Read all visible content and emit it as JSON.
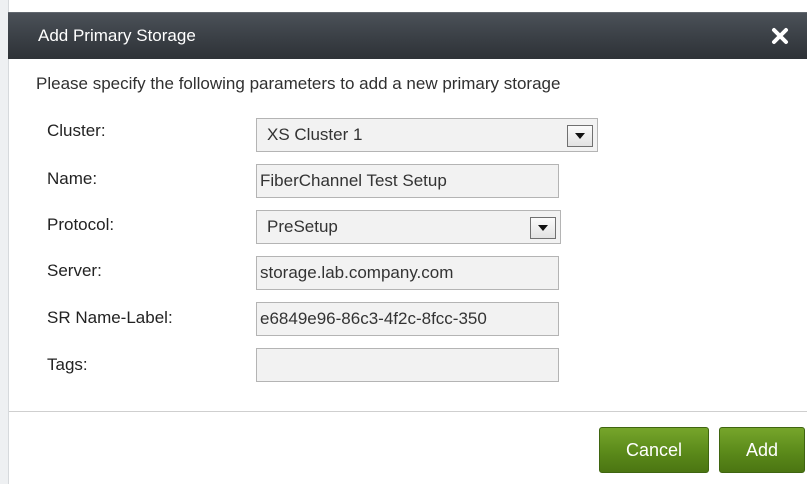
{
  "dialog": {
    "title": "Add Primary Storage",
    "close_icon": "close-icon",
    "intro": "Please specify the following parameters to add a new primary storage"
  },
  "form": {
    "cluster": {
      "label": "Cluster:",
      "value": "XS Cluster 1"
    },
    "name": {
      "label": "Name:",
      "value": "FiberChannel Test Setup"
    },
    "protocol": {
      "label": "Protocol:",
      "value": "PreSetup"
    },
    "server": {
      "label": "Server:",
      "value": "storage.lab.company.com"
    },
    "sr_name_label": {
      "label": "SR Name-Label:",
      "value": "e6849e96-86c3-4f2c-8fcc-350"
    },
    "tags": {
      "label": "Tags:",
      "value": ""
    }
  },
  "buttons": {
    "cancel": "Cancel",
    "add": "Add"
  },
  "colors": {
    "titlebar": "#3a3f45",
    "button_green": "#5b8a1a",
    "field_bg": "#f2f2f2"
  }
}
